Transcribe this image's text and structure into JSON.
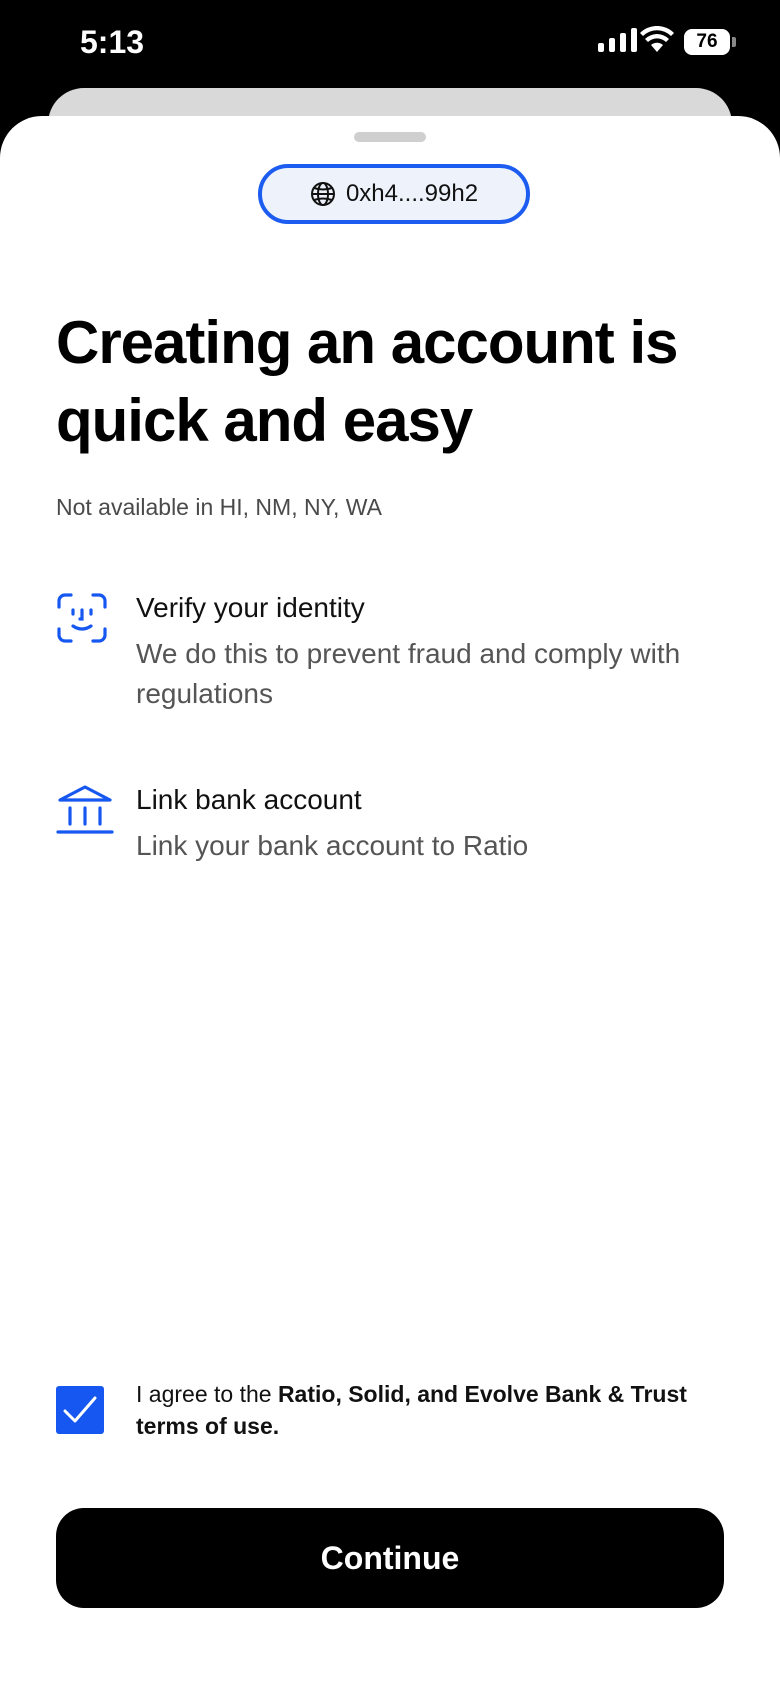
{
  "status_bar": {
    "time": "5:13",
    "battery": "76"
  },
  "header": {
    "wallet_address": "0xh4....99h2"
  },
  "main": {
    "title": "Creating an account is quick and easy",
    "availability_note": "Not available in HI, NM, NY, WA",
    "features": [
      {
        "icon": "face-id-icon",
        "title": "Verify your identity",
        "description": "We do this to prevent fraud and comply with regulations"
      },
      {
        "icon": "bank-icon",
        "title": "Link bank account",
        "description": "Link your bank account to Ratio"
      }
    ]
  },
  "agreement": {
    "checked": true,
    "prefix": "I agree to the ",
    "emphasis": "Ratio, Solid, and Evolve Bank & Trust terms of use."
  },
  "footer": {
    "continue_label": "Continue"
  },
  "colors": {
    "accent": "#1557F0",
    "primary_button": "#000000",
    "pill_bg": "#EEF3FB"
  }
}
